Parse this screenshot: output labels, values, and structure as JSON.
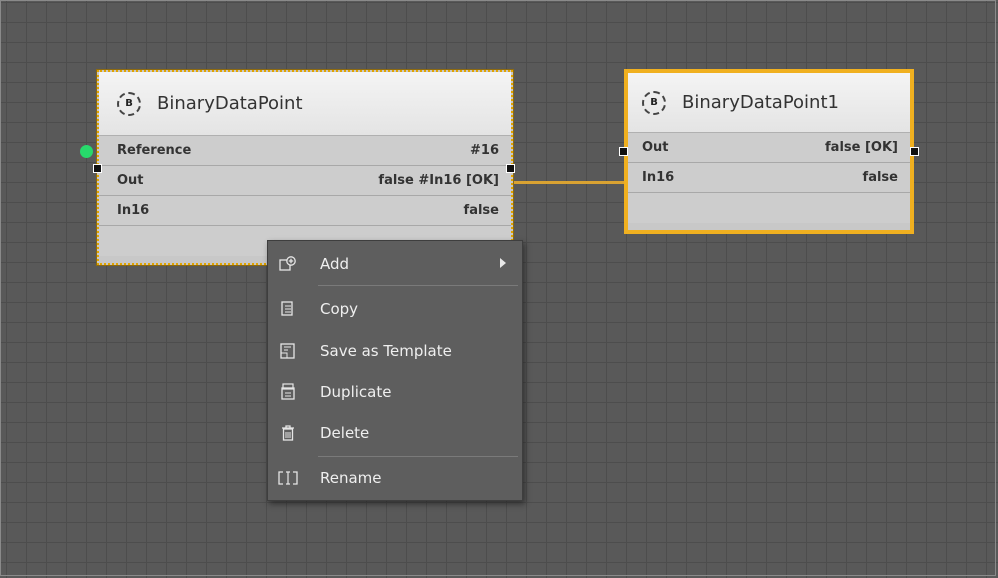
{
  "nodes": [
    {
      "title": "BinaryDataPoint",
      "icon_letter": "B",
      "rows": [
        {
          "label": "Reference",
          "value": "#16"
        },
        {
          "label": "Out",
          "value": "false #In16 [OK]"
        },
        {
          "label": "In16",
          "value": "false"
        }
      ]
    },
    {
      "title": "BinaryDataPoint1",
      "icon_letter": "B",
      "rows": [
        {
          "label": "Out",
          "value": "false [OK]"
        },
        {
          "label": "In16",
          "value": "false"
        }
      ]
    }
  ],
  "context_menu": {
    "items": [
      {
        "label": "Add",
        "icon": "add-icon",
        "has_submenu": true
      },
      {
        "label": "Copy",
        "icon": "copy-icon"
      },
      {
        "label": "Save as Template",
        "icon": "save-template-icon"
      },
      {
        "label": "Duplicate",
        "icon": "duplicate-icon"
      },
      {
        "label": "Delete",
        "icon": "delete-icon"
      },
      {
        "label": "Rename",
        "icon": "rename-icon"
      }
    ]
  },
  "colors": {
    "selection": "#f0b020",
    "wire": "#d9a232",
    "status_dot": "#27d96b"
  }
}
